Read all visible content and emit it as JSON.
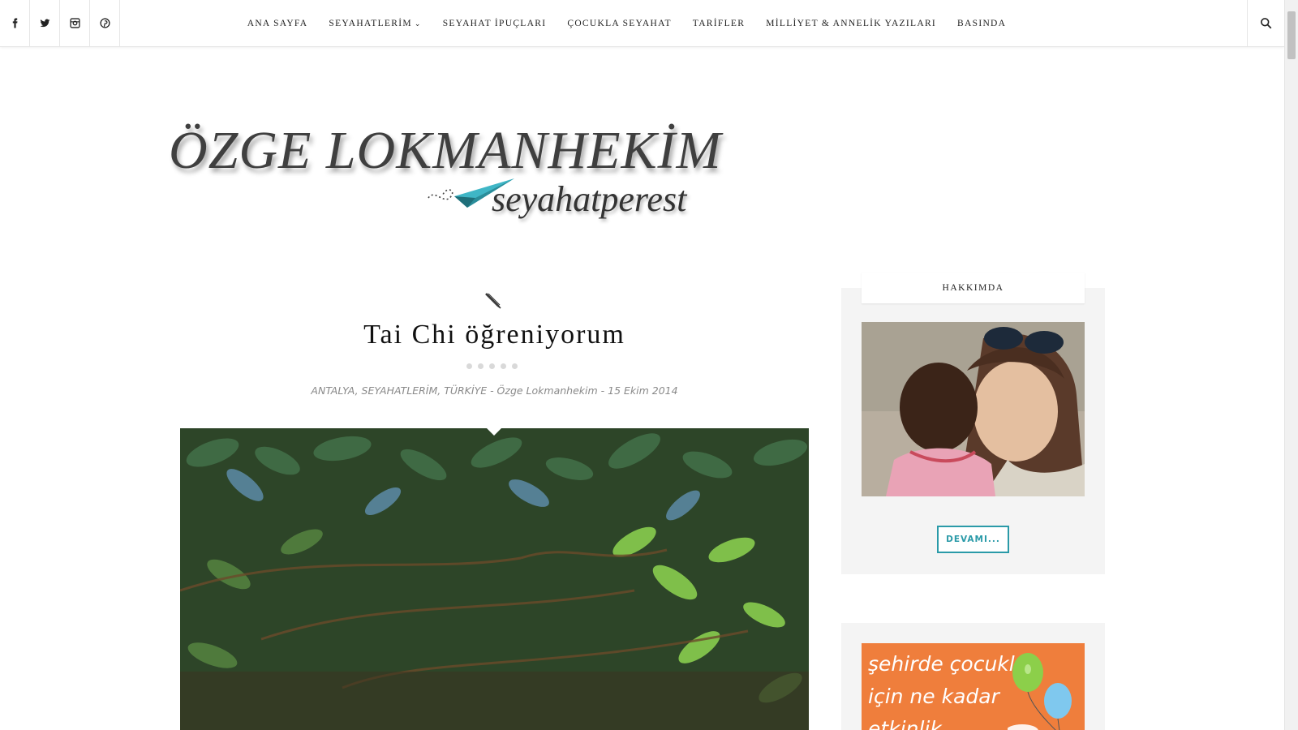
{
  "social": {
    "icons": [
      "facebook-icon",
      "twitter-icon",
      "instagram-icon",
      "pinterest-icon"
    ]
  },
  "nav": {
    "items": [
      {
        "label": "ANA SAYFA"
      },
      {
        "label": "SEYAHATLERİM",
        "has_dropdown": true
      },
      {
        "label": "SEYAHAT İPUÇLARI"
      },
      {
        "label": "ÇOCUKLA SEYAHAT"
      },
      {
        "label": "TARİFLER"
      },
      {
        "label": "MİLLİYET & ANNELİK YAZILARI"
      },
      {
        "label": "BASINDA"
      }
    ],
    "search_icon": "search-icon"
  },
  "logo": {
    "main": "ÖZGE LOKMANHEKİM",
    "sub": "seyahatperest"
  },
  "post": {
    "icon": "pencil-icon",
    "title": "Tai Chi öğreniyorum",
    "meta": "ANTALYA, SEYAHATLERİM, TÜRKİYE - Özge Lokmanhekim - 15 Ekim 2014"
  },
  "sidebar": {
    "about_title": "HAKKIMDA",
    "button_label": "DEVAMI...",
    "promo_text": "şehirde çocuklar\niçin ne kadar\netkinlik"
  },
  "colors": {
    "accent": "#2a9aa8",
    "promo_bg": "#ef7e3c"
  }
}
